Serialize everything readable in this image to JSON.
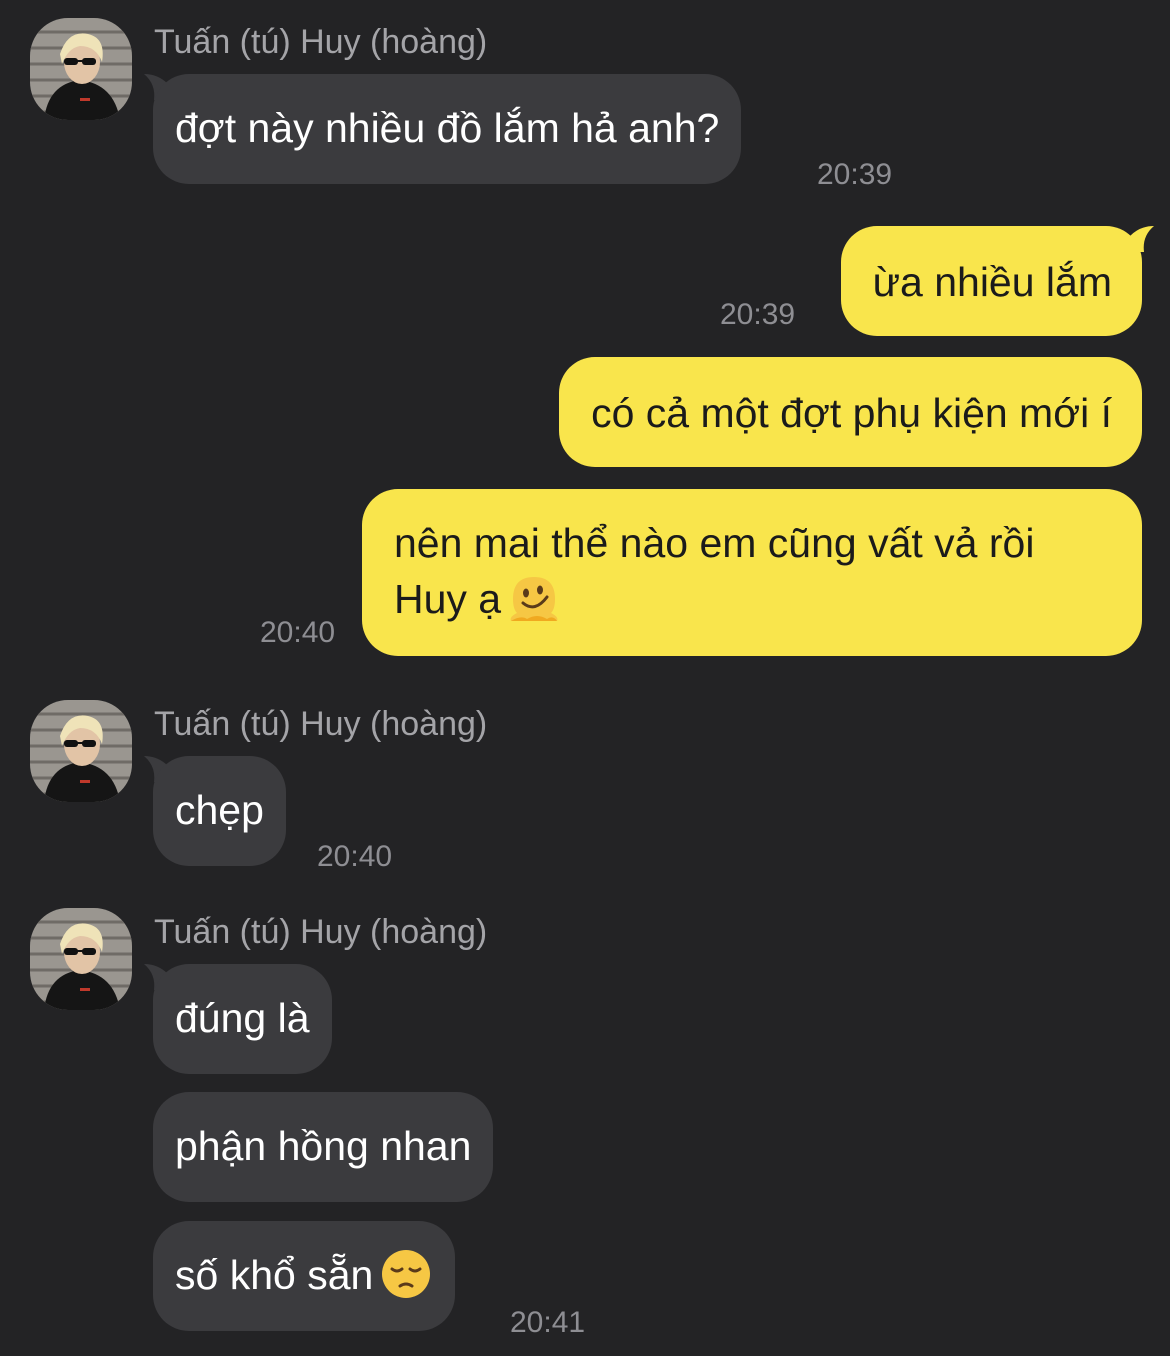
{
  "sender_name": "Tuấn (tú) Huy (hoàng)",
  "messages": [
    {
      "text": "đợt này nhiều đồ lắm hả anh?",
      "time": "20:39"
    },
    {
      "text": "ừa nhiều lắm",
      "time": "20:39"
    },
    {
      "text": "có cả một đợt phụ kiện mới í"
    },
    {
      "text": "nên mai thể nào em cũng vất vả rồi Huy ạ",
      "emoji": "melting-face-emoji",
      "time": "20:40"
    },
    {
      "text": "chẹp",
      "time": "20:40"
    },
    {
      "text": "đúng là"
    },
    {
      "text": "phận hồng nhan"
    },
    {
      "text": "số khổ sẵn",
      "emoji": "pensive-face-emoji",
      "time": "20:41"
    }
  ],
  "colors": {
    "background": "#232325",
    "incoming_bubble": "#3b3b3e",
    "outgoing_bubble": "#f9e54c",
    "sender_text": "#a4a4a8",
    "timestamp_text": "#8e8e93"
  }
}
